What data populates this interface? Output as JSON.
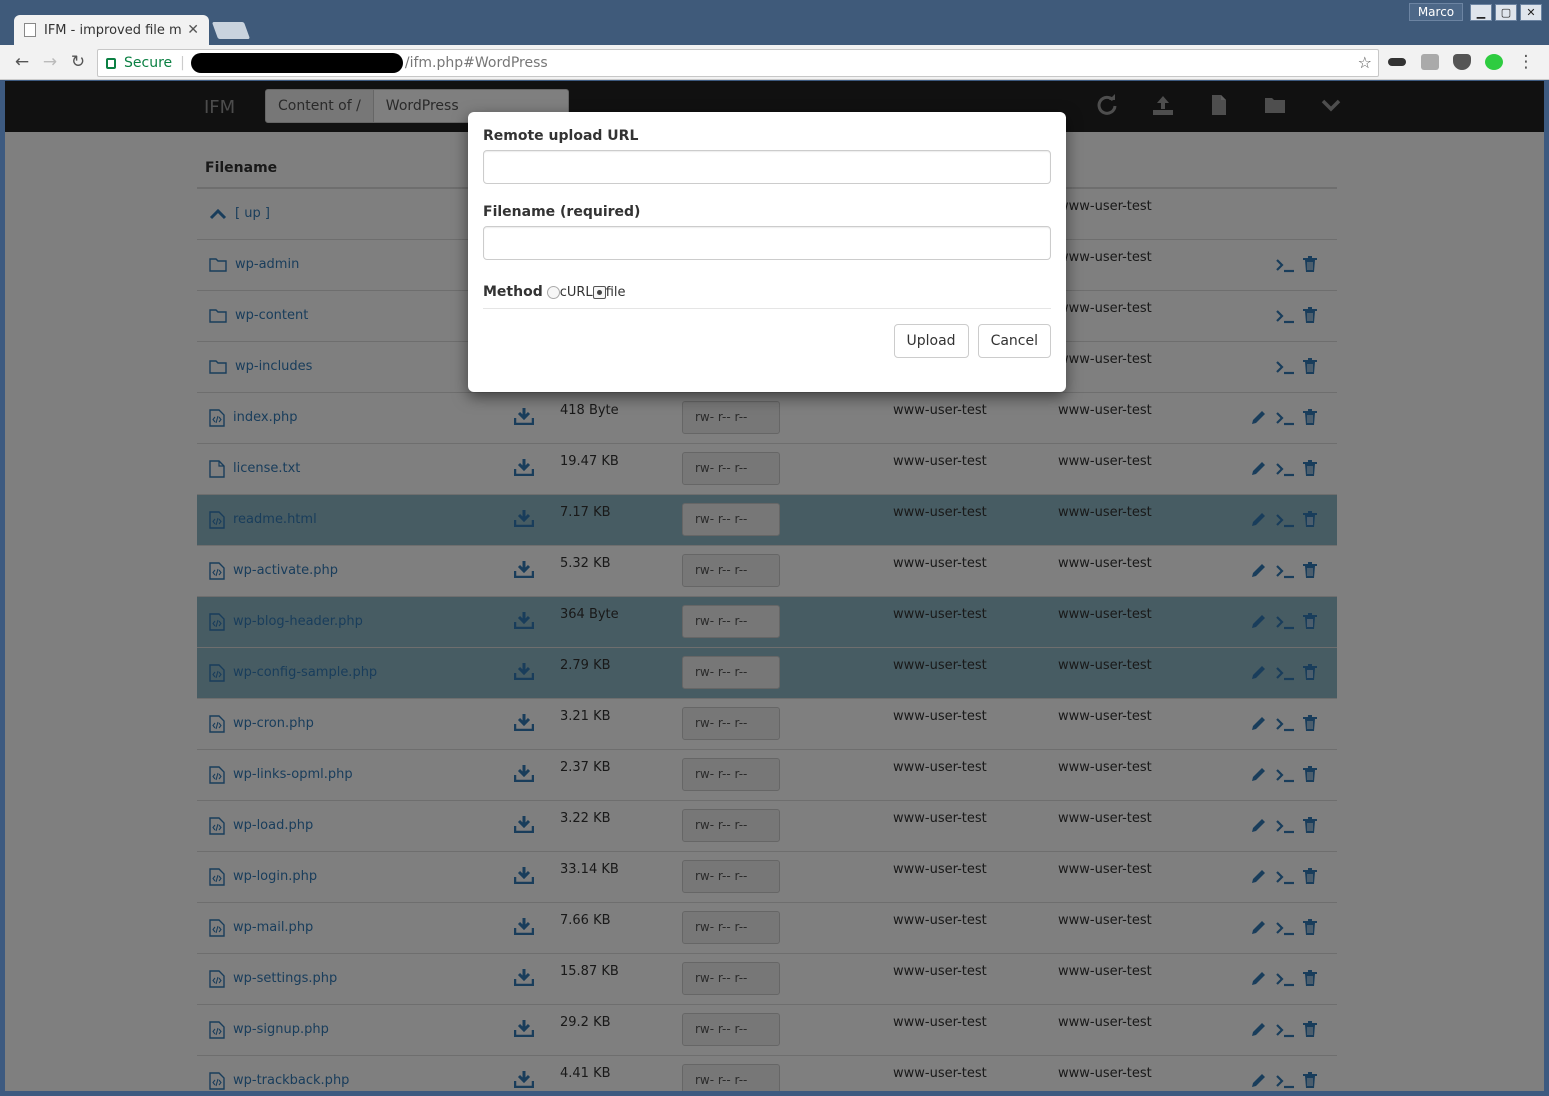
{
  "browser": {
    "tab_title": "IFM - improved file m",
    "user": "Marco",
    "secure_label": "Secure",
    "url_path": "/ifm.php#WordPress"
  },
  "app": {
    "brand": "IFM",
    "path_label": "Content of /",
    "path_value": "WordPress"
  },
  "table": {
    "header_filename": "Filename",
    "up_label": "[ up ]",
    "up_group": "www-user-test",
    "folders": [
      {
        "name": "wp-admin",
        "group": "www-user-test"
      },
      {
        "name": "wp-content",
        "group": "www-user-test"
      },
      {
        "name": "wp-includes",
        "group": "www-user-test"
      }
    ],
    "files": [
      {
        "name": "index.php",
        "size": "418 Byte",
        "perm": "rw- r-- r--",
        "owner": "www-user-test",
        "group": "www-user-test",
        "type": "code",
        "selected": false
      },
      {
        "name": "license.txt",
        "size": "19.47 KB",
        "perm": "rw- r-- r--",
        "owner": "www-user-test",
        "group": "www-user-test",
        "type": "text",
        "selected": false
      },
      {
        "name": "readme.html",
        "size": "7.17 KB",
        "perm": "rw- r-- r--",
        "owner": "www-user-test",
        "group": "www-user-test",
        "type": "code",
        "selected": true
      },
      {
        "name": "wp-activate.php",
        "size": "5.32 KB",
        "perm": "rw- r-- r--",
        "owner": "www-user-test",
        "group": "www-user-test",
        "type": "code",
        "selected": false
      },
      {
        "name": "wp-blog-header.php",
        "size": "364 Byte",
        "perm": "rw- r-- r--",
        "owner": "www-user-test",
        "group": "www-user-test",
        "type": "code",
        "selected": true
      },
      {
        "name": "wp-config-sample.php",
        "size": "2.79 KB",
        "perm": "rw- r-- r--",
        "owner": "www-user-test",
        "group": "www-user-test",
        "type": "code",
        "selected": true
      },
      {
        "name": "wp-cron.php",
        "size": "3.21 KB",
        "perm": "rw- r-- r--",
        "owner": "www-user-test",
        "group": "www-user-test",
        "type": "code",
        "selected": false
      },
      {
        "name": "wp-links-opml.php",
        "size": "2.37 KB",
        "perm": "rw- r-- r--",
        "owner": "www-user-test",
        "group": "www-user-test",
        "type": "code",
        "selected": false
      },
      {
        "name": "wp-load.php",
        "size": "3.22 KB",
        "perm": "rw- r-- r--",
        "owner": "www-user-test",
        "group": "www-user-test",
        "type": "code",
        "selected": false
      },
      {
        "name": "wp-login.php",
        "size": "33.14 KB",
        "perm": "rw- r-- r--",
        "owner": "www-user-test",
        "group": "www-user-test",
        "type": "code",
        "selected": false
      },
      {
        "name": "wp-mail.php",
        "size": "7.66 KB",
        "perm": "rw- r-- r--",
        "owner": "www-user-test",
        "group": "www-user-test",
        "type": "code",
        "selected": false
      },
      {
        "name": "wp-settings.php",
        "size": "15.87 KB",
        "perm": "rw- r-- r--",
        "owner": "www-user-test",
        "group": "www-user-test",
        "type": "code",
        "selected": false
      },
      {
        "name": "wp-signup.php",
        "size": "29.2 KB",
        "perm": "rw- r-- r--",
        "owner": "www-user-test",
        "group": "www-user-test",
        "type": "code",
        "selected": false
      },
      {
        "name": "wp-trackback.php",
        "size": "4.41 KB",
        "perm": "rw- r-- r--",
        "owner": "www-user-test",
        "group": "www-user-test",
        "type": "code",
        "selected": false
      }
    ]
  },
  "modal": {
    "url_label": "Remote upload URL",
    "url_value": "",
    "filename_label": "Filename (required)",
    "filename_value": "",
    "method_label": "Method",
    "method_options": [
      "cURL",
      "file"
    ],
    "method_selected": "file",
    "upload_button": "Upload",
    "cancel_button": "Cancel"
  },
  "colors": {
    "navbar": "#222222",
    "link": "#337ab7",
    "selected_row": "#8eb9c6",
    "window_frame": "#3f5a7a"
  }
}
